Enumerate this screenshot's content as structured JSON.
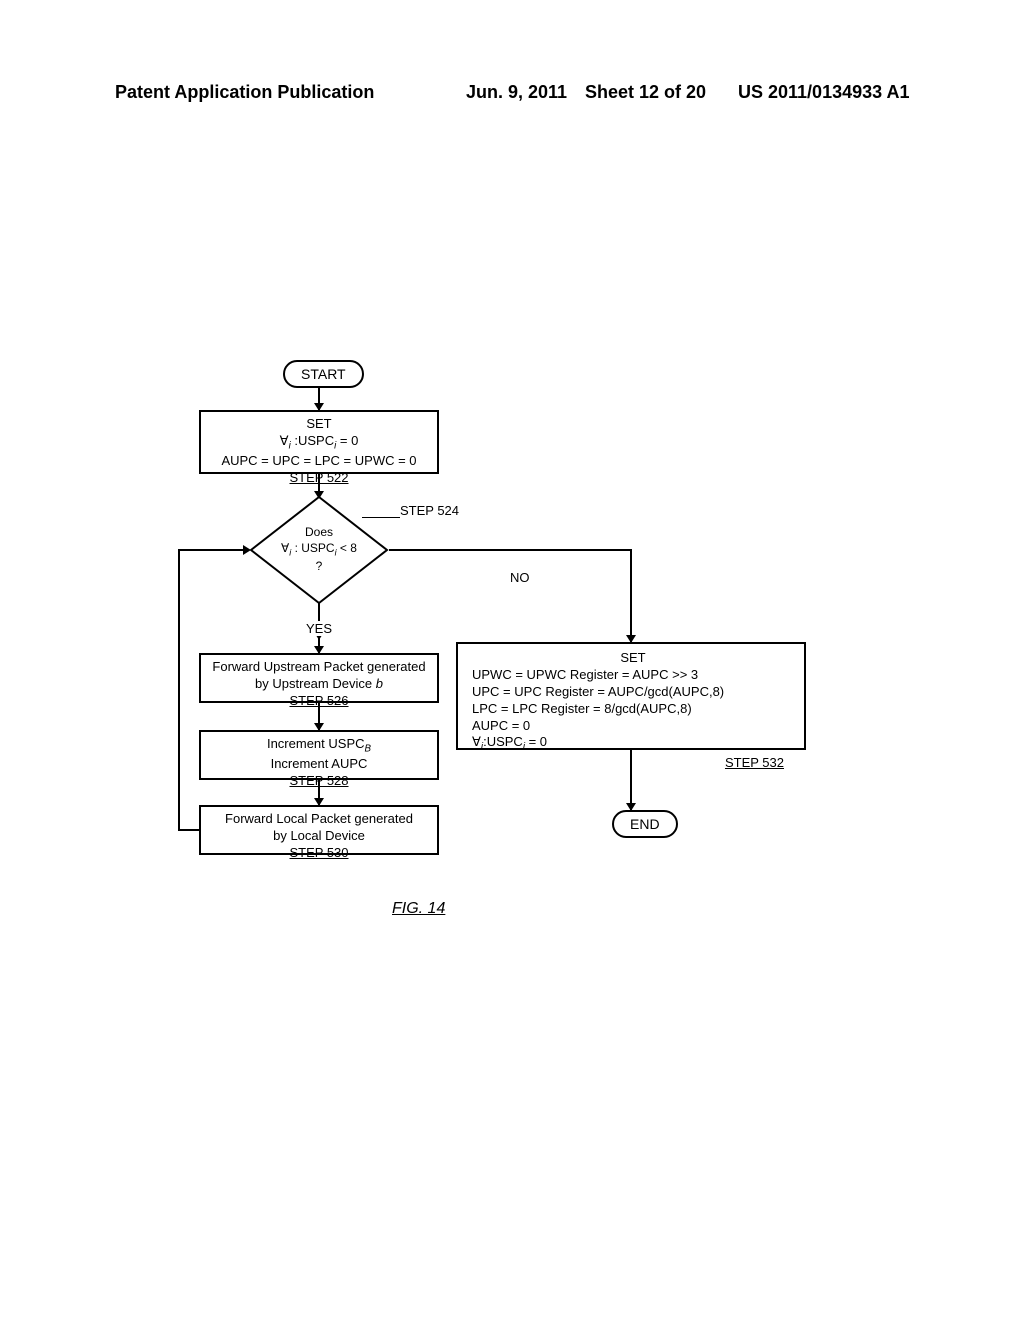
{
  "header": {
    "left": "Patent Application Publication",
    "date": "Jun. 9, 2011",
    "sheet": "Sheet 12 of 20",
    "pubnum": "US 2011/0134933 A1"
  },
  "flowchart": {
    "start": "START",
    "end": "END",
    "step522": {
      "l1": "SET",
      "l2_a": "∀",
      "l2_b": "i",
      "l2_c": " :USPC",
      "l2_d": "i",
      "l2_e": " = 0",
      "l3": "AUPC = UPC = LPC = UPWC = 0",
      "step": "STEP 522"
    },
    "step524": {
      "l1": "Does",
      "l2_a": "∀",
      "l2_b": "i",
      "l2_c": " : USPC",
      "l2_d": "i",
      "l2_e": " < 8",
      "l3": "?",
      "step": "STEP 524"
    },
    "step526": {
      "l1_a": "Forward Upstream Packet generated",
      "l1_b": "by Upstream Device ",
      "l1_c": "b",
      "step": "STEP 526"
    },
    "step528": {
      "l1_a": "Increment USPC",
      "l1_b": "B",
      "l2": "Increment AUPC",
      "step": "STEP 528"
    },
    "step530": {
      "l1": "Forward Local Packet generated",
      "l2": "by Local Device",
      "step": "STEP 530"
    },
    "step532": {
      "l1": "SET",
      "l2": "UPWC = UPWC Register = AUPC >> 3",
      "l3": "UPC = UPC Register = AUPC/gcd(AUPC,8)",
      "l4": "LPC = LPC Register = 8/gcd(AUPC,8)",
      "l5": "AUPC = 0",
      "l6_a": "∀",
      "l6_b": "i",
      "l6_c": ":USPC",
      "l6_d": "i",
      "l6_e": " = 0",
      "step": "STEP 532"
    },
    "yes": "YES",
    "no": "NO"
  },
  "figure_label": "FIG. 14"
}
